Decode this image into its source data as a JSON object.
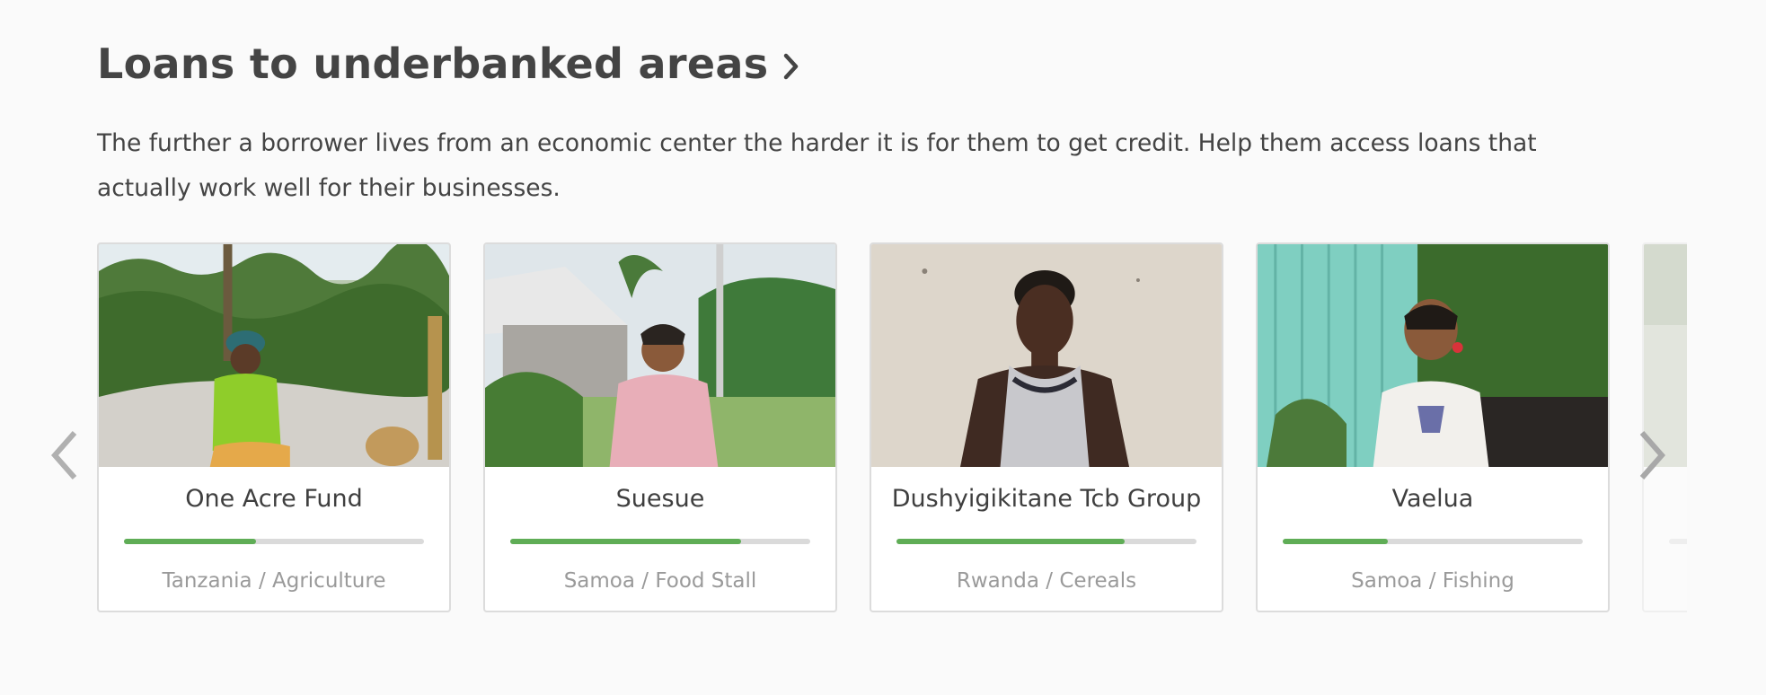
{
  "section": {
    "title": "Loans to underbanked areas",
    "description": "The further a borrower lives from an economic center the harder it is for them to get credit. Help them access loans that actually work well for their businesses."
  },
  "carousel": {
    "prev_icon": "chevron-left-icon",
    "next_icon": "chevron-right-icon",
    "accent_color": "#5fad56",
    "cards": [
      {
        "name": "One Acre Fund",
        "meta": "Tanzania / Agriculture",
        "progress": 0.44
      },
      {
        "name": "Suesue",
        "meta": "Samoa / Food Stall",
        "progress": 0.77
      },
      {
        "name": "Dushyigikitane Tcb Group",
        "meta": "Rwanda / Cereals",
        "progress": 0.76
      },
      {
        "name": "Vaelua",
        "meta": "Samoa / Fishing",
        "progress": 0.35
      }
    ]
  }
}
